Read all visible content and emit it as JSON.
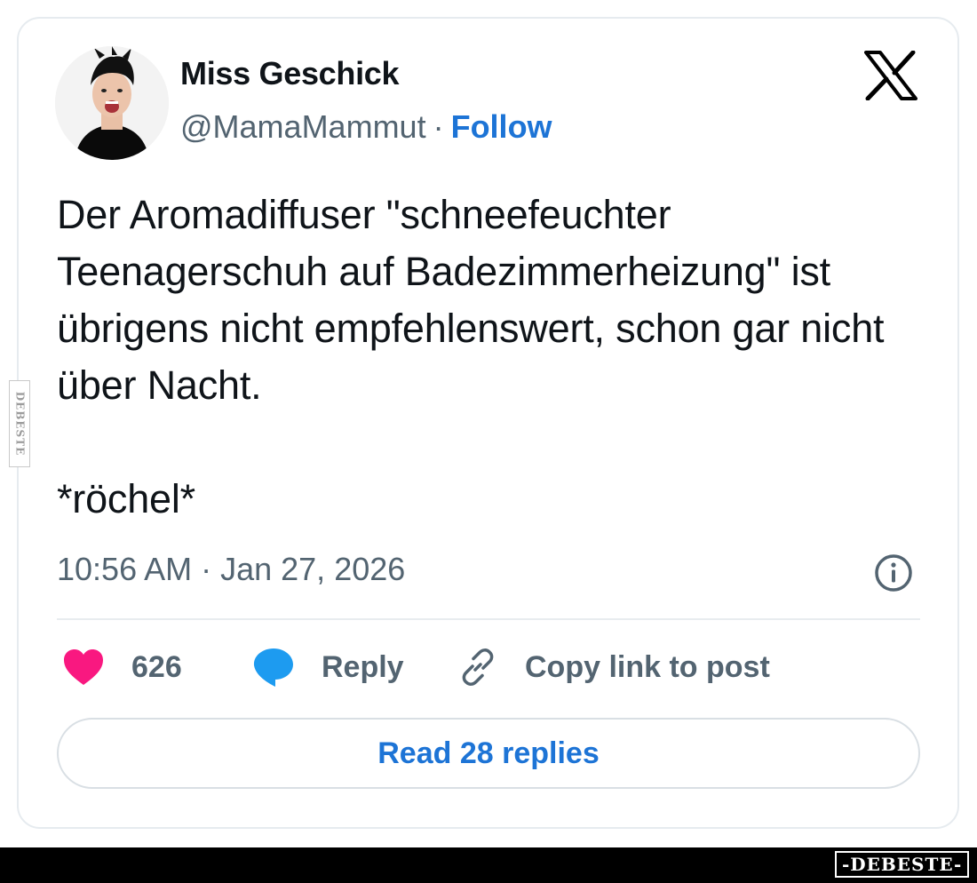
{
  "tweet": {
    "author_name": "Miss Geschick",
    "handle": "@MamaMammut",
    "separator": "·",
    "follow_label": "Follow",
    "text": "Der Aromadiffuser \"schneefeuchter Teenagerschuh auf Badezimmerheizung\" ist übrigens nicht empfehlenswert, schon gar nicht über Nacht.\n\n*röchel*",
    "timestamp": "10:56 AM · Jan 27, 2026"
  },
  "actions": {
    "like_count": "626",
    "reply_label": "Reply",
    "copy_link_label": "Copy link to post"
  },
  "read_replies_label": "Read 28 replies",
  "watermark": {
    "side_text": "DEBESTE",
    "footer_text": "-DEBESTE-"
  },
  "icons": {
    "platform_logo": "x-logo-icon",
    "info": "info-icon",
    "like": "heart-icon",
    "reply": "speech-bubble-icon",
    "copy_link": "link-icon"
  },
  "colors": {
    "text_primary": "#0f1419",
    "text_secondary": "#536471",
    "link_blue": "#1d74d6",
    "like_pink": "#f91880",
    "reply_blue": "#1d9bf0",
    "card_border": "#e6ebef"
  }
}
